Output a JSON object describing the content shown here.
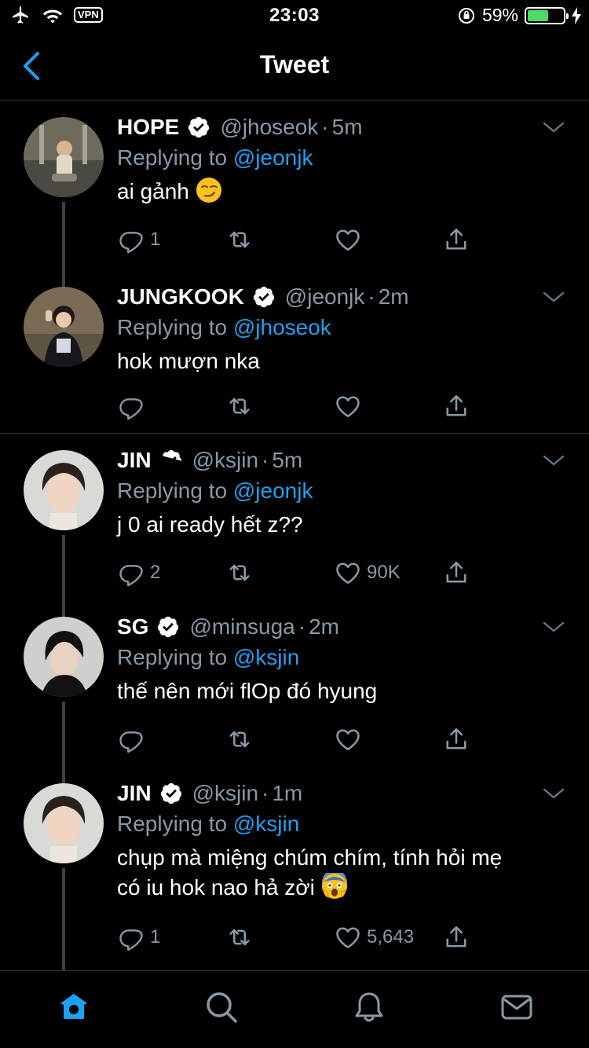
{
  "status_bar": {
    "time": "23:03",
    "vpn": "VPN",
    "battery": "59%",
    "battery_level": 0.59
  },
  "nav": {
    "title": "Tweet"
  },
  "tweets": [
    {
      "name": "HOPE",
      "handle": "@jhoseok",
      "age": "5m",
      "replying_prefix": "Replying to",
      "replying_to": "@jeonjk",
      "text": "ai gảnh",
      "emoji": "smirk-emoji",
      "replies": "1",
      "retweets": "",
      "likes": ""
    },
    {
      "name": "JUNGKOOK",
      "handle": "@jeonjk",
      "age": "2m",
      "replying_prefix": "Replying to",
      "replying_to": "@jhoseok",
      "text": "hok mượn nka",
      "emoji": "",
      "replies": "",
      "retweets": "",
      "likes": ""
    },
    {
      "name": "JIN",
      "handle": "@ksjin",
      "age": "5m",
      "replying_prefix": "Replying to",
      "replying_to": "@jeonjk",
      "text": "j 0 ai ready hết z??",
      "emoji": "",
      "replies": "2",
      "retweets": "",
      "likes": "90K"
    },
    {
      "name": "SG",
      "handle": "@minsuga",
      "age": "2m",
      "replying_prefix": "Replying to",
      "replying_to": "@ksjin",
      "text": "thế nên mới flOp đó hyung",
      "emoji": "",
      "replies": "",
      "retweets": "",
      "likes": ""
    },
    {
      "name": "JIN",
      "handle": "@ksjin",
      "age": "1m",
      "replying_prefix": "Replying to",
      "replying_to": "@ksjin",
      "text_line1": "chụp mà miệng chúm chím, tính hỏi mẹ",
      "text_line2": "có iu hok nao hả zời",
      "emoji": "scream-emoji",
      "replies": "1",
      "retweets": "",
      "likes": "5,643"
    }
  ],
  "tab_bar": {
    "tabs": [
      "home-icon",
      "search-icon",
      "notifications-icon",
      "messages-icon"
    ],
    "active": "home-icon"
  },
  "colors": {
    "accent": "#1da1f2",
    "muted": "#8899a6",
    "background": "#000000",
    "verified_badge": "#ffffff"
  }
}
